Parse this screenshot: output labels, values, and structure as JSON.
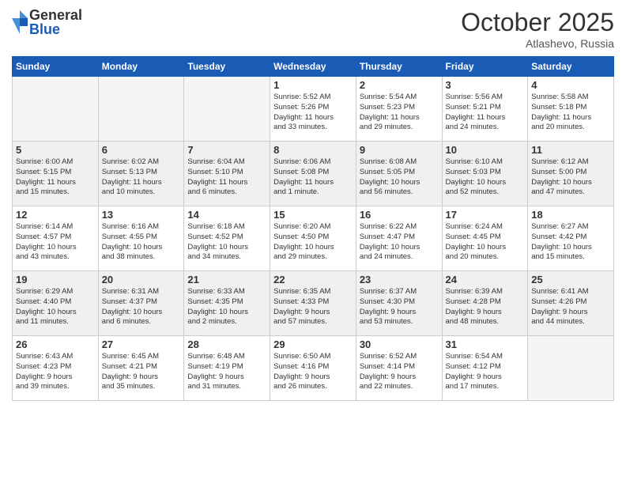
{
  "header": {
    "logo_general": "General",
    "logo_blue": "Blue",
    "title": "October 2025",
    "location": "Atlashevo, Russia"
  },
  "weekdays": [
    "Sunday",
    "Monday",
    "Tuesday",
    "Wednesday",
    "Thursday",
    "Friday",
    "Saturday"
  ],
  "weeks": [
    [
      {
        "day": "",
        "info": "",
        "empty": true
      },
      {
        "day": "",
        "info": "",
        "empty": true
      },
      {
        "day": "",
        "info": "",
        "empty": true
      },
      {
        "day": "1",
        "info": "Sunrise: 5:52 AM\nSunset: 5:26 PM\nDaylight: 11 hours\nand 33 minutes."
      },
      {
        "day": "2",
        "info": "Sunrise: 5:54 AM\nSunset: 5:23 PM\nDaylight: 11 hours\nand 29 minutes."
      },
      {
        "day": "3",
        "info": "Sunrise: 5:56 AM\nSunset: 5:21 PM\nDaylight: 11 hours\nand 24 minutes."
      },
      {
        "day": "4",
        "info": "Sunrise: 5:58 AM\nSunset: 5:18 PM\nDaylight: 11 hours\nand 20 minutes."
      }
    ],
    [
      {
        "day": "5",
        "info": "Sunrise: 6:00 AM\nSunset: 5:15 PM\nDaylight: 11 hours\nand 15 minutes.",
        "shaded": true
      },
      {
        "day": "6",
        "info": "Sunrise: 6:02 AM\nSunset: 5:13 PM\nDaylight: 11 hours\nand 10 minutes.",
        "shaded": true
      },
      {
        "day": "7",
        "info": "Sunrise: 6:04 AM\nSunset: 5:10 PM\nDaylight: 11 hours\nand 6 minutes.",
        "shaded": true
      },
      {
        "day": "8",
        "info": "Sunrise: 6:06 AM\nSunset: 5:08 PM\nDaylight: 11 hours\nand 1 minute.",
        "shaded": true
      },
      {
        "day": "9",
        "info": "Sunrise: 6:08 AM\nSunset: 5:05 PM\nDaylight: 10 hours\nand 56 minutes.",
        "shaded": true
      },
      {
        "day": "10",
        "info": "Sunrise: 6:10 AM\nSunset: 5:03 PM\nDaylight: 10 hours\nand 52 minutes.",
        "shaded": true
      },
      {
        "day": "11",
        "info": "Sunrise: 6:12 AM\nSunset: 5:00 PM\nDaylight: 10 hours\nand 47 minutes.",
        "shaded": true
      }
    ],
    [
      {
        "day": "12",
        "info": "Sunrise: 6:14 AM\nSunset: 4:57 PM\nDaylight: 10 hours\nand 43 minutes."
      },
      {
        "day": "13",
        "info": "Sunrise: 6:16 AM\nSunset: 4:55 PM\nDaylight: 10 hours\nand 38 minutes."
      },
      {
        "day": "14",
        "info": "Sunrise: 6:18 AM\nSunset: 4:52 PM\nDaylight: 10 hours\nand 34 minutes."
      },
      {
        "day": "15",
        "info": "Sunrise: 6:20 AM\nSunset: 4:50 PM\nDaylight: 10 hours\nand 29 minutes."
      },
      {
        "day": "16",
        "info": "Sunrise: 6:22 AM\nSunset: 4:47 PM\nDaylight: 10 hours\nand 24 minutes."
      },
      {
        "day": "17",
        "info": "Sunrise: 6:24 AM\nSunset: 4:45 PM\nDaylight: 10 hours\nand 20 minutes."
      },
      {
        "day": "18",
        "info": "Sunrise: 6:27 AM\nSunset: 4:42 PM\nDaylight: 10 hours\nand 15 minutes."
      }
    ],
    [
      {
        "day": "19",
        "info": "Sunrise: 6:29 AM\nSunset: 4:40 PM\nDaylight: 10 hours\nand 11 minutes.",
        "shaded": true
      },
      {
        "day": "20",
        "info": "Sunrise: 6:31 AM\nSunset: 4:37 PM\nDaylight: 10 hours\nand 6 minutes.",
        "shaded": true
      },
      {
        "day": "21",
        "info": "Sunrise: 6:33 AM\nSunset: 4:35 PM\nDaylight: 10 hours\nand 2 minutes.",
        "shaded": true
      },
      {
        "day": "22",
        "info": "Sunrise: 6:35 AM\nSunset: 4:33 PM\nDaylight: 9 hours\nand 57 minutes.",
        "shaded": true
      },
      {
        "day": "23",
        "info": "Sunrise: 6:37 AM\nSunset: 4:30 PM\nDaylight: 9 hours\nand 53 minutes.",
        "shaded": true
      },
      {
        "day": "24",
        "info": "Sunrise: 6:39 AM\nSunset: 4:28 PM\nDaylight: 9 hours\nand 48 minutes.",
        "shaded": true
      },
      {
        "day": "25",
        "info": "Sunrise: 6:41 AM\nSunset: 4:26 PM\nDaylight: 9 hours\nand 44 minutes.",
        "shaded": true
      }
    ],
    [
      {
        "day": "26",
        "info": "Sunrise: 6:43 AM\nSunset: 4:23 PM\nDaylight: 9 hours\nand 39 minutes."
      },
      {
        "day": "27",
        "info": "Sunrise: 6:45 AM\nSunset: 4:21 PM\nDaylight: 9 hours\nand 35 minutes."
      },
      {
        "day": "28",
        "info": "Sunrise: 6:48 AM\nSunset: 4:19 PM\nDaylight: 9 hours\nand 31 minutes."
      },
      {
        "day": "29",
        "info": "Sunrise: 6:50 AM\nSunset: 4:16 PM\nDaylight: 9 hours\nand 26 minutes."
      },
      {
        "day": "30",
        "info": "Sunrise: 6:52 AM\nSunset: 4:14 PM\nDaylight: 9 hours\nand 22 minutes."
      },
      {
        "day": "31",
        "info": "Sunrise: 6:54 AM\nSunset: 4:12 PM\nDaylight: 9 hours\nand 17 minutes."
      },
      {
        "day": "",
        "info": "",
        "empty": true
      }
    ]
  ]
}
